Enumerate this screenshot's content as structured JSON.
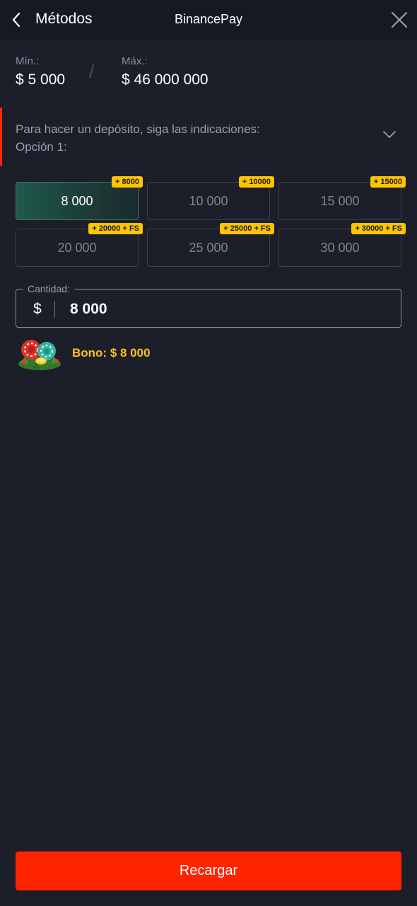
{
  "header": {
    "back_label": "Métodos",
    "method_title": "BinancePay"
  },
  "limits": {
    "min_label": "Mín.:",
    "min_value": "$ 5 000",
    "separator": "/",
    "max_label": "Máx.:",
    "max_value": "$ 46 000 000"
  },
  "instructions": {
    "line1": "Para hacer un depósito, siga las indicaciones:",
    "line2": "Opción 1:"
  },
  "amounts": [
    {
      "value": "8 000",
      "badge": "+ 8000",
      "selected": true
    },
    {
      "value": "10 000",
      "badge": "+ 10000",
      "selected": false
    },
    {
      "value": "15 000",
      "badge": "+ 15000",
      "selected": false
    },
    {
      "value": "20 000",
      "badge": "+ 20000 + FS",
      "selected": false
    },
    {
      "value": "25 000",
      "badge": "+ 25000 + FS",
      "selected": false
    },
    {
      "value": "30 000",
      "badge": "+ 30000 + FS",
      "selected": false
    }
  ],
  "quantity": {
    "label": "Cantidad:",
    "currency": "$",
    "value": "8 000"
  },
  "bonus": {
    "text": "Bono: $ 8 000",
    "icon": "casino-chips-icon"
  },
  "submit_label": "Recargar",
  "colors": {
    "background": "#1c1f2a",
    "header": "#161923",
    "accent": "#ff2400",
    "badge": "#ffc400",
    "bonus_text": "#ffbf1f",
    "selected_fill": "#1f5a4c"
  },
  "icons": {
    "back": "chevron-left-icon",
    "close": "close-icon",
    "expand": "chevron-down-icon"
  }
}
